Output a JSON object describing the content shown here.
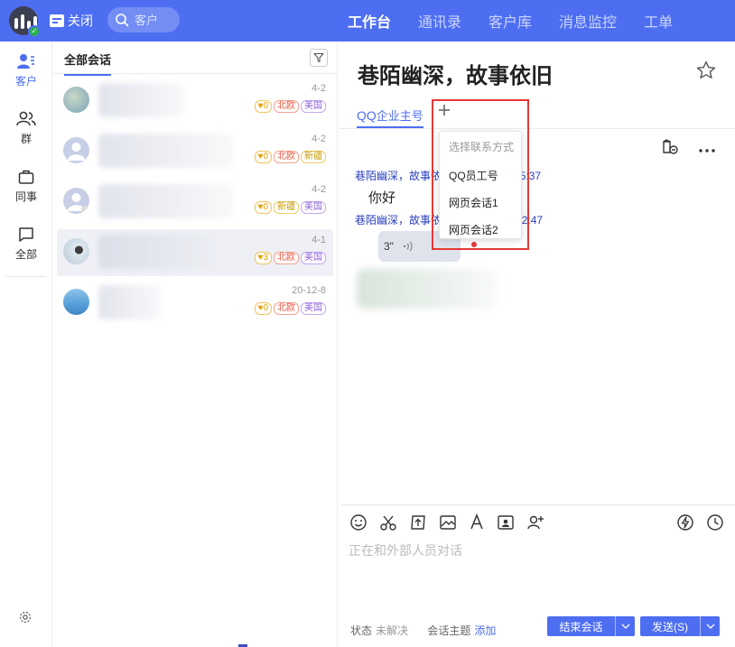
{
  "topbar": {
    "close_label": "关闭",
    "search_placeholder": "客户",
    "nav": [
      "工作台",
      "通讯录",
      "客户库",
      "消息监控",
      "工单"
    ],
    "accent": "#4e6ef2"
  },
  "rail": {
    "items": [
      {
        "label": "客户",
        "icon": "customer-icon"
      },
      {
        "label": "群",
        "icon": "group-icon"
      },
      {
        "label": "同事",
        "icon": "briefcase-icon"
      },
      {
        "label": "全部",
        "icon": "chat-bubble-icon"
      }
    ]
  },
  "session_list": {
    "tab_label": "全部会话",
    "sessions": [
      {
        "date": "4-2",
        "tags": [
          {
            "text": "♥0",
            "style": "gold"
          },
          {
            "text": "北欧",
            "style": "red"
          },
          {
            "text": "美国",
            "style": "purple"
          }
        ]
      },
      {
        "date": "4-2",
        "tags": [
          {
            "text": "♥0",
            "style": "gold"
          },
          {
            "text": "北欧",
            "style": "red"
          },
          {
            "text": "新疆",
            "style": "yellow"
          }
        ]
      },
      {
        "date": "4-2",
        "tags": [
          {
            "text": "♥0",
            "style": "gold"
          },
          {
            "text": "新疆",
            "style": "yellow"
          },
          {
            "text": "美国",
            "style": "purple"
          }
        ]
      },
      {
        "date": "4-1",
        "tags": [
          {
            "text": "♥3",
            "style": "gold"
          },
          {
            "text": "北欧",
            "style": "red"
          },
          {
            "text": "美国",
            "style": "purple"
          }
        ]
      },
      {
        "date": "20-12-8",
        "tags": [
          {
            "text": "♥0",
            "style": "gold"
          },
          {
            "text": "北欧",
            "style": "red"
          },
          {
            "text": "美国",
            "style": "purple"
          }
        ]
      }
    ]
  },
  "chat": {
    "title": "巷陌幽深，故事依旧",
    "tab_prefix": "QQ",
    "tab_suffix": "企业主号",
    "messages": [
      {
        "sender": "巷陌幽深，故事依",
        "time": "9:25:37",
        "text": "你好"
      },
      {
        "sender": "巷陌幽深，故事依",
        "time": "12:47",
        "voice_duration": "3\""
      }
    ],
    "dropdown": {
      "title": "选择联系方式",
      "items": [
        "QQ员工号",
        "网页会话1",
        "网页会话2"
      ]
    }
  },
  "composer": {
    "placeholder": "正在和外部人员对话",
    "status_label": "状态",
    "status_value": "未解决",
    "topic_label": "会话主题",
    "topic_link": "添加",
    "end_button": "结束会话",
    "send_button": "发送(S)"
  }
}
